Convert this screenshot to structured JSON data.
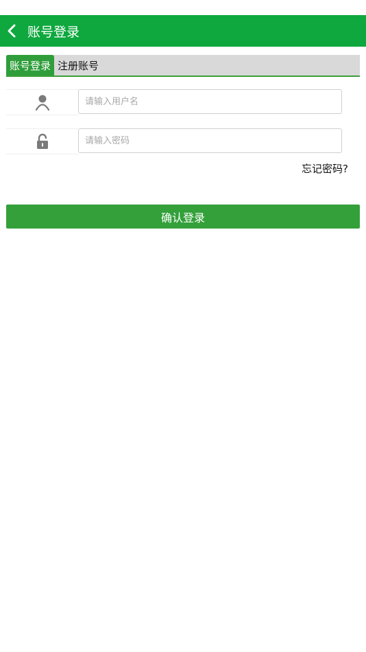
{
  "header": {
    "title": "账号登录",
    "back_icon": "chevron-left-icon"
  },
  "tabs": [
    {
      "label": "账号登录",
      "active": true
    },
    {
      "label": "注册账号",
      "active": false
    }
  ],
  "form": {
    "username": {
      "placeholder": "请输入用户名",
      "value": "",
      "icon": "user-icon"
    },
    "password": {
      "placeholder": "请输入密码",
      "value": "",
      "icon": "lock-icon"
    },
    "forgot_label": "忘记密码?",
    "submit_label": "确认登录"
  },
  "colors": {
    "header_bg": "#0ea83e",
    "accent": "#33a03a",
    "tab_bar_bg": "#d9d9d9"
  }
}
